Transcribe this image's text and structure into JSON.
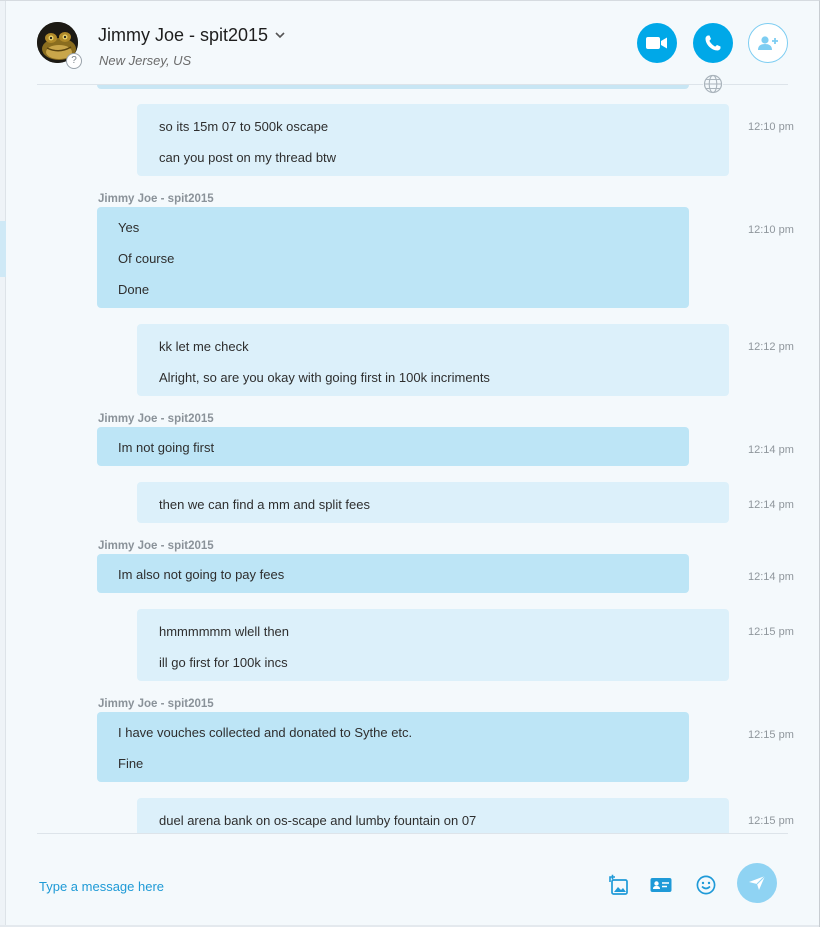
{
  "header": {
    "contact_name": "Jimmy Joe - spit2015",
    "location": "New Jersey, US",
    "presence_symbol": "?",
    "accent_color": "#00a8e8"
  },
  "messages": [
    {
      "direction": "out",
      "lines": [
        "so its 15m 07 to 500k oscape",
        "can you post on my thread btw"
      ],
      "time": "12:10 pm"
    },
    {
      "direction": "in",
      "sender": "Jimmy Joe - spit2015",
      "lines": [
        "Yes",
        "Of course",
        "Done"
      ],
      "time": "12:10 pm"
    },
    {
      "direction": "out",
      "lines": [
        "kk  let me check",
        "Alright, so are you okay with going first in 100k incriments"
      ],
      "time": "12:12 pm"
    },
    {
      "direction": "in",
      "sender": "Jimmy Joe - spit2015",
      "lines": [
        "Im not going first"
      ],
      "time": "12:14 pm"
    },
    {
      "direction": "out",
      "lines": [
        "then we can find a mm and split fees"
      ],
      "time": "12:14 pm"
    },
    {
      "direction": "in",
      "sender": "Jimmy Joe - spit2015",
      "lines": [
        "Im also not going to pay fees"
      ],
      "time": "12:14 pm"
    },
    {
      "direction": "out",
      "lines": [
        "hmmmmmm wlell then",
        "ill go first for 100k incs"
      ],
      "time": "12:15 pm"
    },
    {
      "direction": "in",
      "sender": "Jimmy Joe - spit2015",
      "lines": [
        "I have vouches collected and donated to Sythe etc.",
        "Fine"
      ],
      "time": "12:15 pm"
    },
    {
      "direction": "out",
      "lines": [
        "duel arena bank on os-scape and lumby fountain on 07"
      ],
      "time": "12:15 pm"
    }
  ],
  "composer": {
    "placeholder": "Type a message here"
  },
  "icons": {
    "header": [
      "video-call-icon",
      "audio-call-icon",
      "add-people-icon"
    ],
    "composer": [
      "send-image-icon",
      "send-contact-icon",
      "emoticon-icon",
      "send-icon"
    ],
    "misc": [
      "globe-icon",
      "chevron-down-icon"
    ]
  }
}
